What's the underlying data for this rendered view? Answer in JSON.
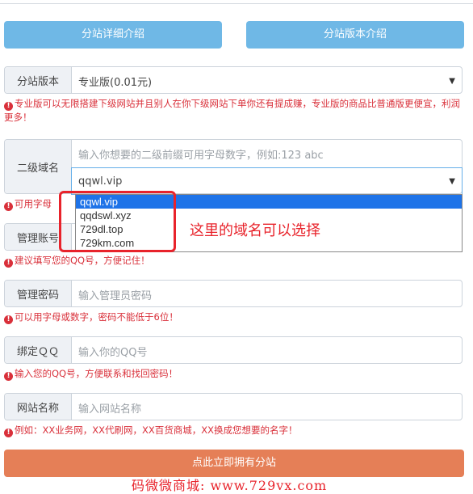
{
  "buttons": {
    "detail": "分站详细介绍",
    "version": "分站版本介绍"
  },
  "version_row": {
    "label": "分站版本",
    "selected": "专业版(0.01元)"
  },
  "version_hint": "专业版可以无限搭建下级网站并且别人在你下级网站下单你还有提成赚，专业版的商品比普通版更便宜，利润更多！",
  "domain_row": {
    "label": "二级域名",
    "placeholder": "输入你想要的二级前缀可用字母数字，例如:123 abc",
    "selected": "qqwl.vip",
    "options": [
      "qqwl.vip",
      "qqdswl.xyz",
      "729dl.top",
      "729km.com"
    ]
  },
  "domain_hint": "可用字母",
  "annotation": "这里的域名可以选择",
  "account_row": {
    "label": "管理账号"
  },
  "account_hint": "建议填写您的QQ号，方便记住！",
  "password_row": {
    "label": "管理密码",
    "placeholder": "输入管理员密码"
  },
  "password_hint": "可以用字母或数字，密码不能低于6位！",
  "qq_row": {
    "label": "绑定ＱＱ",
    "placeholder": "输入你的QQ号"
  },
  "qq_hint": "输入您的QQ号，方便联系和找回密码！",
  "sitename_row": {
    "label": "网站名称",
    "placeholder": "输入网站名称"
  },
  "sitename_hint": "例如：XX业务网，XX代刷网，XX百货商城，XX换成您想要的名字！",
  "submit": "点此立即拥有分站",
  "watermark": "码微微商城: www.729vx.com",
  "colors": {
    "primary_button": "#6fb8e6",
    "submit_button": "#e57f57",
    "hint_red": "#d9303a",
    "highlight": "#1e73e8"
  }
}
